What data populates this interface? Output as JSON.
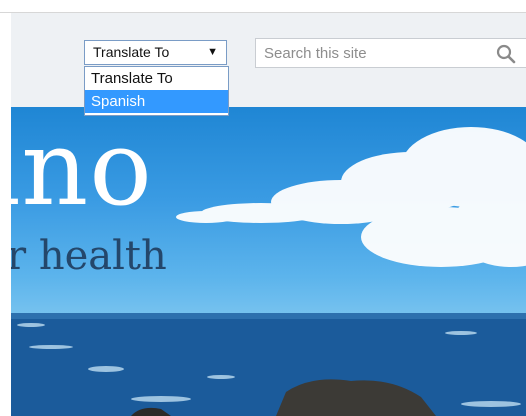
{
  "header": {
    "translate": {
      "selected_label": "Translate To",
      "arrow_glyph": "▼",
      "options": [
        "Translate To",
        "Spanish"
      ],
      "highlighted_option": "Spanish"
    },
    "search": {
      "placeholder": "Search this site",
      "icon": "search-icon"
    }
  },
  "hero": {
    "title_partial": "ino",
    "tagline_partial": "r health"
  },
  "colors": {
    "header_bg": "#eef1f4",
    "select_border": "#7a9cc6",
    "highlight": "#3399ff",
    "tagline": "#24476b"
  }
}
